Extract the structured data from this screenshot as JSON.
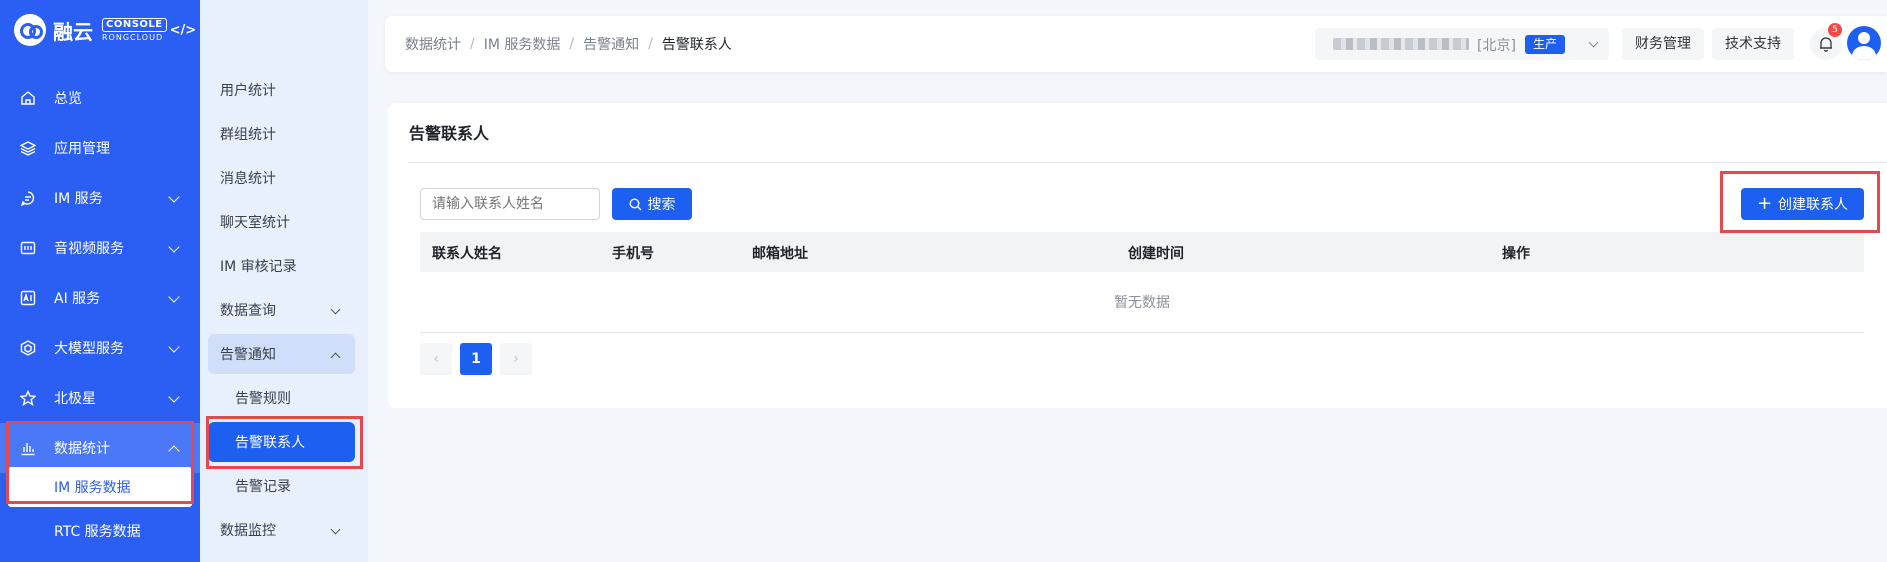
{
  "brand": {
    "name": "融云",
    "badge_top": "CONSOLE",
    "badge_bottom": "RONGCLOUD",
    "code_glyph": "</>"
  },
  "sidebar": {
    "items": [
      {
        "label": "总览",
        "icon": "home-icon"
      },
      {
        "label": "应用管理",
        "icon": "layers-icon"
      },
      {
        "label": "IM 服务",
        "icon": "chat-icon"
      },
      {
        "label": "音视频服务",
        "icon": "video-icon"
      },
      {
        "label": "AI 服务",
        "icon": "ai-icon"
      },
      {
        "label": "大模型服务",
        "icon": "model-icon"
      },
      {
        "label": "北极星",
        "icon": "star-icon"
      },
      {
        "label": "数据统计",
        "icon": "chart-icon"
      }
    ],
    "sub_items": [
      {
        "label": "IM 服务数据"
      },
      {
        "label": "RTC 服务数据"
      }
    ]
  },
  "subnav": {
    "items": [
      {
        "label": "用户统计"
      },
      {
        "label": "群组统计"
      },
      {
        "label": "消息统计"
      },
      {
        "label": "聊天室统计"
      },
      {
        "label": "IM 审核记录"
      },
      {
        "label": "数据查询"
      },
      {
        "label": "告警通知"
      },
      {
        "label": "告警规则"
      },
      {
        "label": "告警联系人"
      },
      {
        "label": "告警记录"
      },
      {
        "label": "数据监控"
      }
    ]
  },
  "header": {
    "breadcrumb": [
      "数据统计",
      "IM 服务数据",
      "告警通知",
      "告警联系人"
    ],
    "breadcrumb_sep": "/",
    "region": "[北京]",
    "env_tag": "生产",
    "finance_label": "财务管理",
    "support_label": "技术支持",
    "notification_count": "5"
  },
  "main": {
    "title": "告警联系人",
    "search_placeholder": "请输入联系人姓名",
    "search_label": "搜索",
    "create_label": "创建联系人",
    "columns": [
      "联系人姓名",
      "手机号",
      "邮箱地址",
      "创建时间",
      "操作"
    ],
    "empty_text": "暂无数据",
    "pagination": {
      "current": "1",
      "prev": "‹",
      "next": "›"
    }
  },
  "colors": {
    "primary": "#1d5ff0",
    "sidebar": "#2b5ff3",
    "highlight": "#e5484d"
  }
}
